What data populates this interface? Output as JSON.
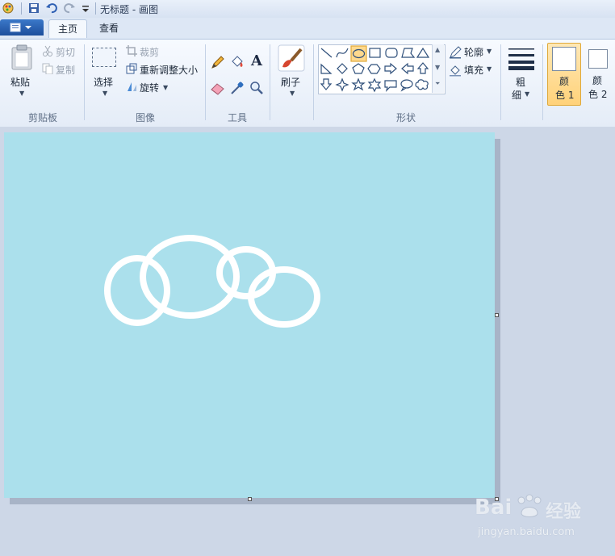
{
  "titlebar": {
    "title": "无标题 - 画图"
  },
  "tabs": {
    "home": "主页",
    "view": "查看"
  },
  "clipboard": {
    "paste": "粘贴",
    "cut": "剪切",
    "copy": "复制",
    "group": "剪贴板"
  },
  "image": {
    "select": "选择",
    "crop": "裁剪",
    "resize": "重新调整大小",
    "rotate": "旋转",
    "group": "图像"
  },
  "tools": {
    "group": "工具",
    "text_glyph": "A"
  },
  "brushes": {
    "label": "刷子"
  },
  "shapes": {
    "outline": "轮廓",
    "fill": "填充",
    "group": "形状"
  },
  "size": {
    "label_1": "粗",
    "label_2": "细"
  },
  "colors": {
    "color1_a": "颜",
    "color1_b": "色 1",
    "color2_a": "颜",
    "color2_b": "色 2",
    "canvas_bg": "#abe0ec",
    "stroke": "#ffffff",
    "accent_selected": "#ffd98e"
  },
  "watermark": {
    "brand": "Bai",
    "brand_tail": "经验",
    "url": "jingyan.baidu.com"
  }
}
